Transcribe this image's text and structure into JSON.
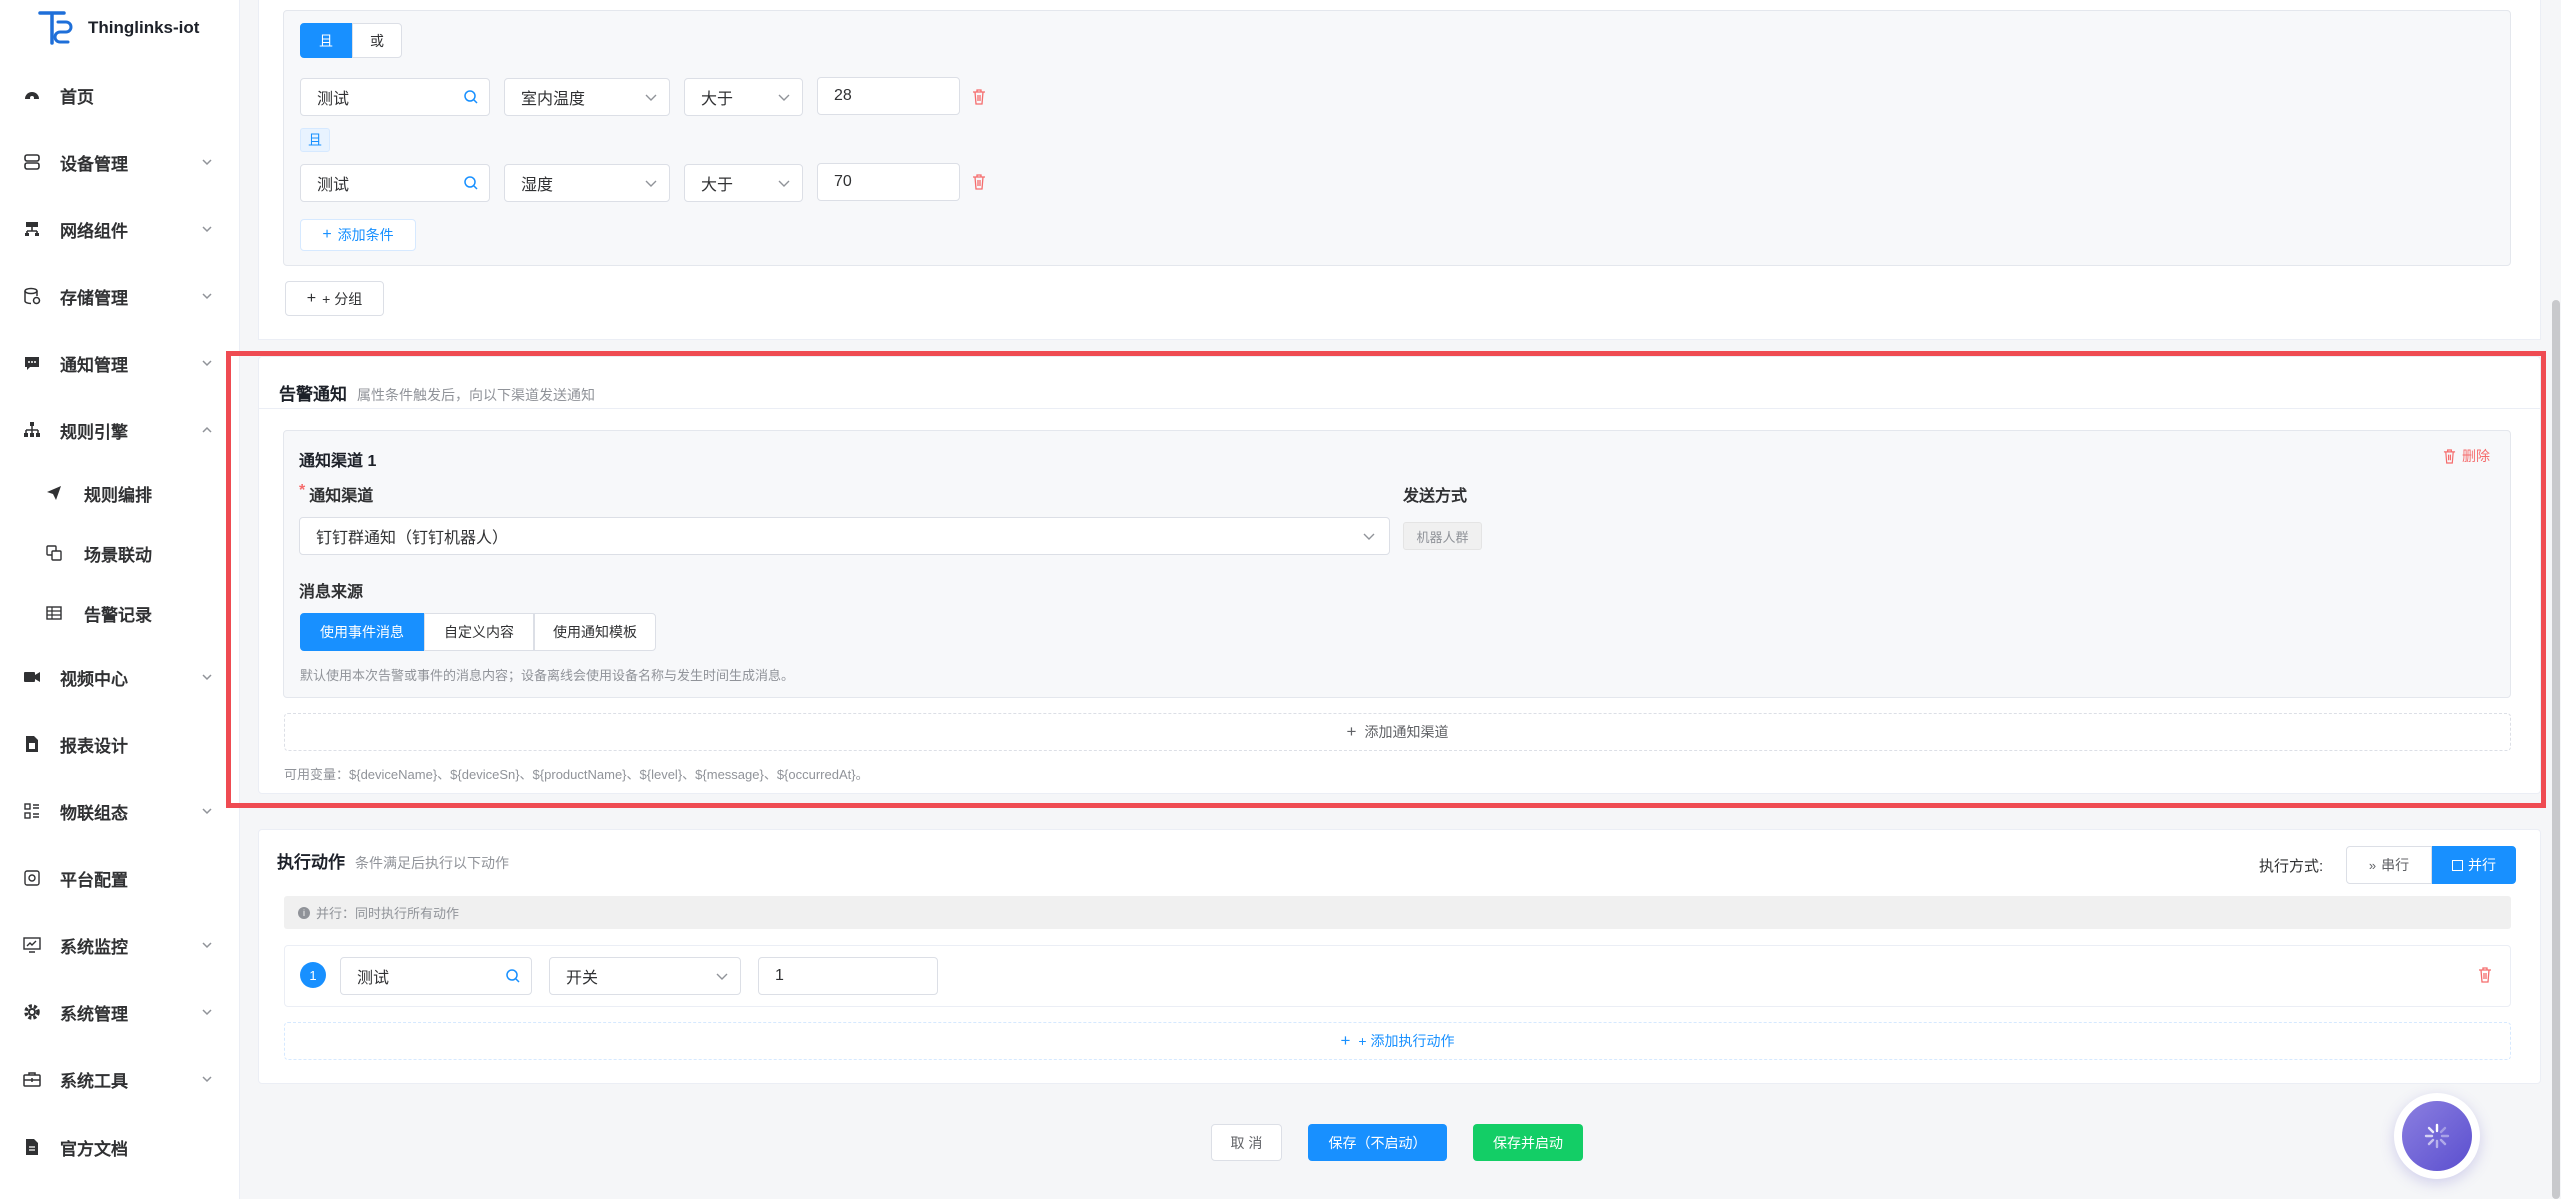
{
  "app": {
    "logo_text": "Thinglinks-iot"
  },
  "sidebar": {
    "items": [
      {
        "label": "首页",
        "icon": "dashboard-icon"
      },
      {
        "label": "设备管理",
        "icon": "device-icon",
        "caret": "down"
      },
      {
        "label": "网络组件",
        "icon": "network-icon",
        "caret": "down"
      },
      {
        "label": "存储管理",
        "icon": "database-icon",
        "caret": "down"
      },
      {
        "label": "通知管理",
        "icon": "message-icon",
        "caret": "down"
      },
      {
        "label": "规则引擎",
        "icon": "tree-icon",
        "caret": "up"
      },
      {
        "label": "规则编排",
        "icon": "send-icon",
        "sub": true
      },
      {
        "label": "场景联动",
        "icon": "copy-icon",
        "sub": true
      },
      {
        "label": "告警记录",
        "icon": "table-icon",
        "sub": true
      },
      {
        "label": "视频中心",
        "icon": "video-icon",
        "caret": "down"
      },
      {
        "label": "报表设计",
        "icon": "report-icon"
      },
      {
        "label": "物联组态",
        "icon": "config-icon",
        "caret": "down"
      },
      {
        "label": "平台配置",
        "icon": "platform-icon"
      },
      {
        "label": "系统监控",
        "icon": "monitor-icon",
        "caret": "down"
      },
      {
        "label": "系统管理",
        "icon": "gear-icon",
        "caret": "down"
      },
      {
        "label": "系统工具",
        "icon": "toolbox-icon",
        "caret": "down"
      },
      {
        "label": "官方文档",
        "icon": "doc-icon"
      }
    ]
  },
  "conditions": {
    "logic_and": "且",
    "logic_or": "或",
    "rows": [
      {
        "device": "测试",
        "property": "室内温度",
        "operator": "大于",
        "value": "28"
      },
      {
        "device": "测试",
        "property": "湿度",
        "operator": "大于",
        "value": "70"
      }
    ],
    "join_tag": "且",
    "add_condition": "添加条件",
    "add_group": "+ 分组"
  },
  "alarm": {
    "title": "告警通知",
    "subtitle": "属性条件触发后，向以下渠道发送通知",
    "channel_title": "通知渠道 1",
    "delete_label": "删除",
    "channel_label": "通知渠道",
    "channel_required": "*",
    "channel_value": "钉钉群通知（钉钉机器人）",
    "send_method_label": "发送方式",
    "send_method_value": "机器人群",
    "source_label": "消息来源",
    "source_options": [
      "使用事件消息",
      "自定义内容",
      "使用通知模板"
    ],
    "source_hint": "默认使用本次告警或事件的消息内容；设备离线会使用设备名称与发生时间生成消息。",
    "add_channel": "添加通知渠道",
    "variables": "可用变量：${deviceName}、${deviceSn}、${productName}、${level}、${message}、${occurredAt}。"
  },
  "actions": {
    "title": "执行动作",
    "subtitle": "条件满足后执行以下动作",
    "mode_label": "执行方式:",
    "mode_serial": "串行",
    "mode_parallel": "并行",
    "info": "并行：同时执行所有动作",
    "rows": [
      {
        "index": "1",
        "device": "测试",
        "property": "开关",
        "value": "1"
      }
    ],
    "add_action": "+ 添加执行动作"
  },
  "footer": {
    "cancel": "取 消",
    "save": "保存（不启动）",
    "save_start": "保存并启动"
  },
  "colors": {
    "primary": "#1890ff",
    "success": "#13ce66",
    "danger": "#f56c6c",
    "highlight": "#ef4b52"
  }
}
